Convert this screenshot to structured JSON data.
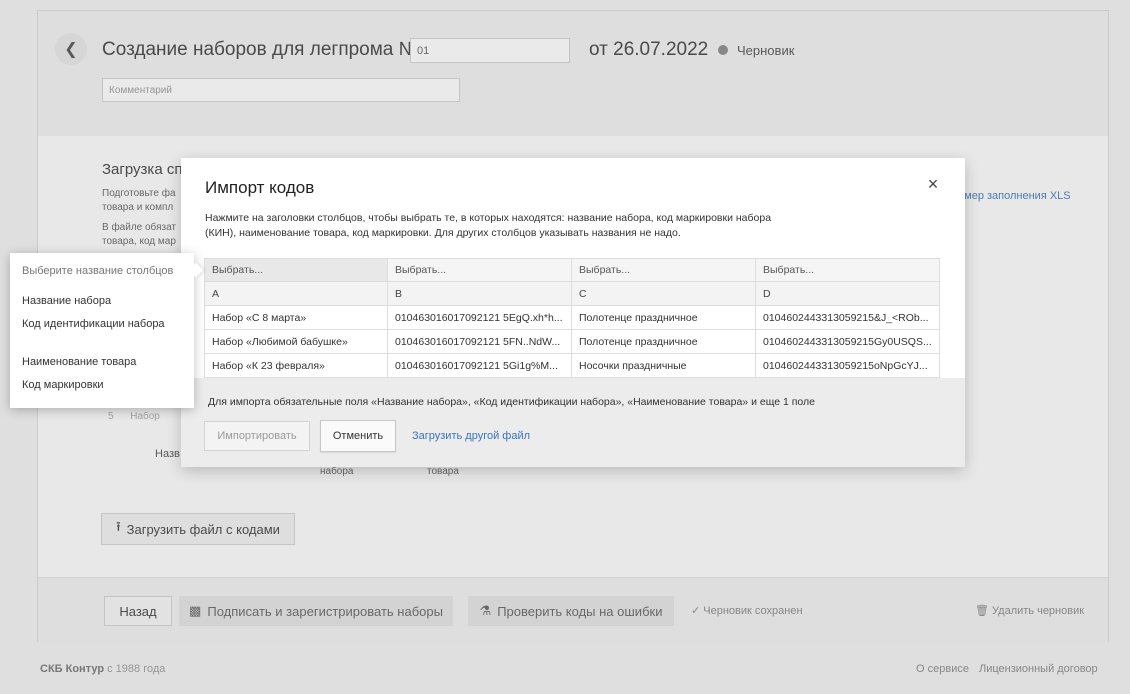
{
  "page": {
    "title": "Создание наборов для легпрома №",
    "number_value": "01",
    "date": "от 26.07.2022",
    "status": "Черновик",
    "comment_placeholder": "Комментарий",
    "upload_title": "Загрузка сп",
    "upload_desc_1": "Подготовьте фа",
    "upload_desc_1b": "товара и компл",
    "upload_desc_2": "В файле обязат",
    "upload_desc_2b": "товара, код мар",
    "xls_link": "имер заполнения XLS",
    "bg_row_num": "5",
    "bg_row_text": "Набор",
    "bg_col_1": "Назв",
    "bg_col_2": "набора",
    "bg_col_3": "товара",
    "upload_file_button": "Загрузить файл с кодами"
  },
  "footer_bar": {
    "back": "Назад",
    "sign": "Подписать и зарегистрировать наборы",
    "check": "Проверить коды на ошибки",
    "saved": "Черновик сохранен",
    "delete": "Удалить черновик"
  },
  "bottom": {
    "brand": "СКБ Контур",
    "since": "с 1988 года",
    "about": "О сервисе",
    "license": "Лицензионный договор"
  },
  "modal": {
    "title": "Импорт кодов",
    "close": "×",
    "description": "Нажмите на заголовки столбцов, чтобы выбрать те, в которых находятся: название набора, код маркировки набора (КИН), наименование товара, код маркировки. Для других столбцов указывать названия не надо.",
    "column_selectors": [
      "Выбрать...",
      "Выбрать...",
      "Выбрать...",
      "Выбрать..."
    ],
    "column_letters": [
      "A",
      "B",
      "C",
      "D"
    ],
    "rows": [
      [
        "Набор «С 8 марта»",
        "010463016017092121 5EgQ.xh*h...",
        "Полотенце праздничное",
        "0104602443313059215&J_<ROb..."
      ],
      [
        "Набор «Любимой бабушке»",
        "010463016017092121 5FN..NdW...",
        "Полотенце праздничное",
        "0104602443313059215Gy0USQS..."
      ],
      [
        "Набор «К 23 февраля»",
        "010463016017092121 5Gi1g%M...",
        "Носочки праздничные",
        "0104602443313059215oNpGcYJ..."
      ]
    ],
    "required_note": "Для импорта обязательные поля «Название набора», «Код идентификации набора», «Наименование товара» и еще 1 поле",
    "import_button": "Импортировать",
    "cancel_button": "Отменить",
    "upload_other": "Загрузить другой файл"
  },
  "popup": {
    "header": "Выберите название столбцов",
    "items": [
      "Название набора",
      "Код идентификации набора",
      "Наименование товара",
      "Код маркировки"
    ]
  }
}
